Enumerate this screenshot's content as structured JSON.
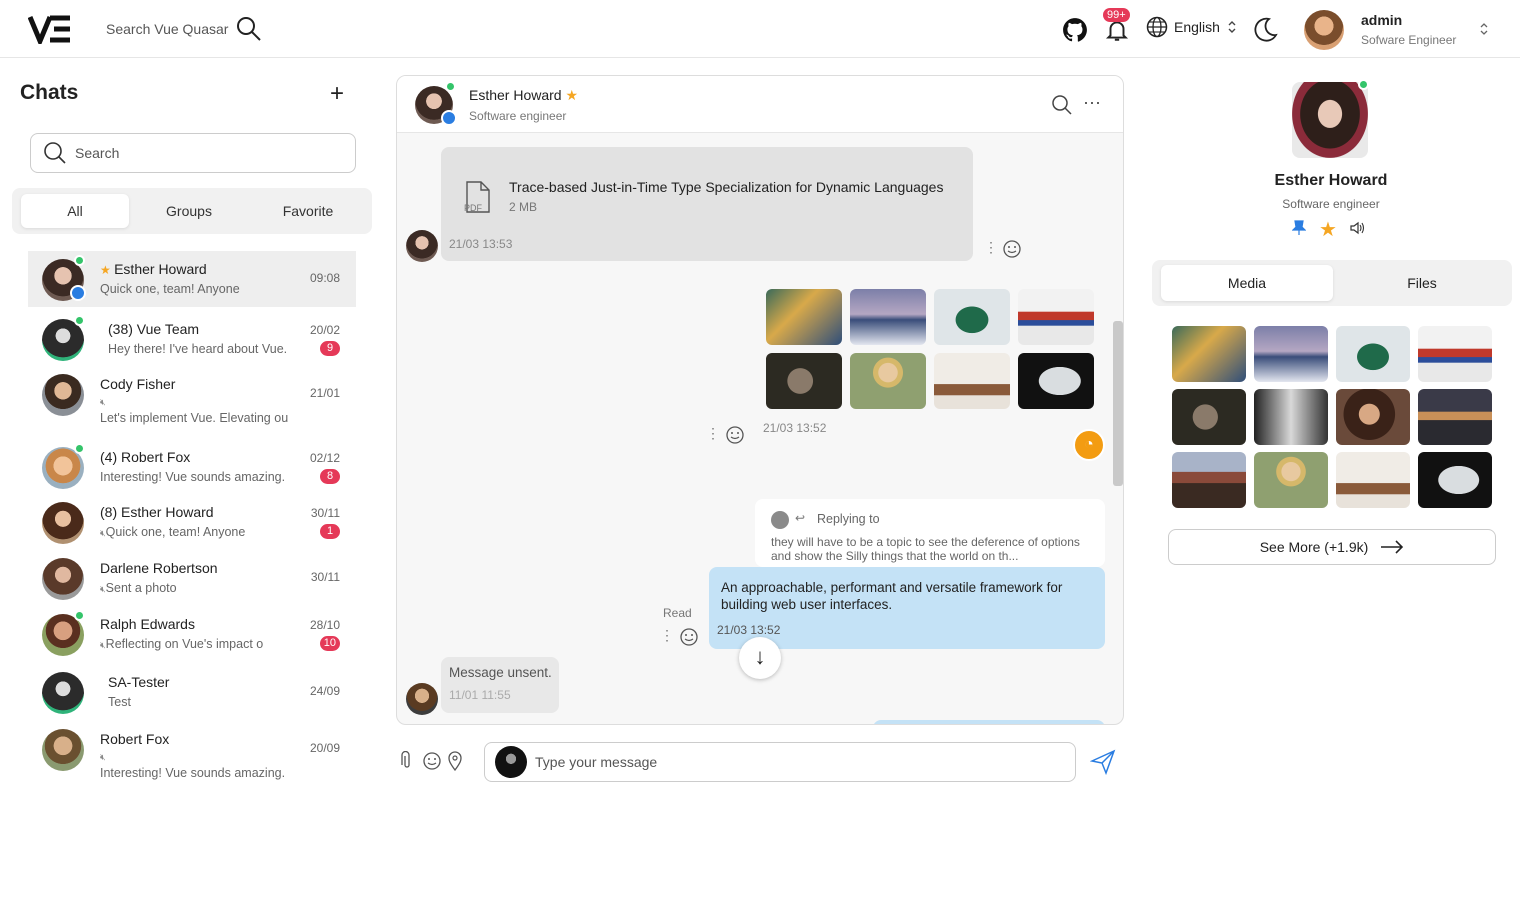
{
  "topbar": {
    "search_placeholder": "Search Vue Quasar",
    "notif_badge": "99+",
    "language": "English",
    "user_name": "admin",
    "user_role": "Sofware Engineer"
  },
  "left": {
    "title": "Chats",
    "search_placeholder": "Search",
    "tabs": [
      "All",
      "Groups",
      "Favorite"
    ],
    "chats": [
      {
        "name": "Esther Howard",
        "msg": "Quick one, team! Anyone",
        "time": "09:08",
        "badge": "",
        "star": true,
        "muted": false,
        "online": true
      },
      {
        "name": "(38) Vue Team",
        "msg": "Hey there! I've heard about Vue.",
        "time": "20/02",
        "badge": "9",
        "star": false,
        "muted": false,
        "online": true
      },
      {
        "name": "Cody Fisher",
        "msg": "Let's implement Vue. Elevating ou",
        "time": "21/01",
        "badge": "",
        "star": false,
        "muted": true,
        "online": false
      },
      {
        "name": "(4) Robert Fox",
        "msg": "Interesting! Vue sounds amazing.",
        "time": "02/12",
        "badge": "8",
        "star": false,
        "muted": false,
        "online": true
      },
      {
        "name": "(8) Esther Howard",
        "msg": "Quick one, team! Anyone",
        "time": "30/11",
        "badge": "1",
        "star": false,
        "muted": true,
        "online": false
      },
      {
        "name": "Darlene Robertson",
        "msg": "Sent a photo",
        "time": "30/11",
        "badge": "",
        "star": false,
        "muted": true,
        "online": false
      },
      {
        "name": "Ralph Edwards",
        "msg": "Reflecting on Vue's impact o",
        "time": "28/10",
        "badge": "10",
        "star": false,
        "muted": true,
        "online": true
      },
      {
        "name": "SA-Tester",
        "msg": "Test",
        "time": "24/09",
        "badge": "",
        "star": false,
        "muted": false,
        "online": false
      },
      {
        "name": "Robert Fox",
        "msg": "Interesting! Vue sounds amazing.",
        "time": "20/09",
        "badge": "",
        "star": false,
        "muted": true,
        "online": false
      }
    ]
  },
  "chat": {
    "name": "Esther Howard",
    "role": "Software engineer",
    "file_name": "Trace-based Just-in-Time Type Specialization for Dynamic Languages",
    "file_size": "2 MB",
    "file_label": "PDF",
    "file_time": "21/03 13:53",
    "images_time": "21/03 13:52",
    "reply_label": "Replying to",
    "reply_text": "they will have to be a topic to see the deference of options and show the Silly things that the world on th...",
    "my_msg": "An approachable, performant and versatile framework for building web user interfaces.",
    "my_time": "21/03 13:52",
    "read_label": "Read",
    "unsent": "Message unsent.",
    "unsent_time": "11/01 11:55",
    "input_placeholder": "Type your message"
  },
  "profile": {
    "name": "Esther Howard",
    "role": "Software engineer",
    "tabs": [
      "Media",
      "Files"
    ],
    "see_more": "See More (+1.9k)"
  },
  "colors": {
    "accent": "#2a7de1",
    "badge": "#e53958",
    "online": "#34c46a",
    "my_bubble": "#c4e2f6",
    "star": "#f5a623"
  }
}
